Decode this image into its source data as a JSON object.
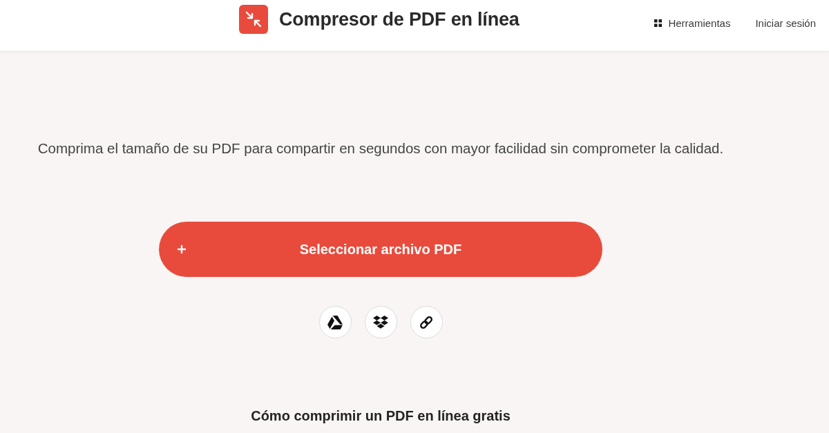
{
  "header": {
    "title": "Compresor de PDF en línea",
    "nav": [
      {
        "kind": "menu",
        "label": "Herramientas"
      },
      {
        "kind": "link",
        "label": "Iniciar sesión"
      }
    ]
  },
  "subtitle": "Comprima el tamaño de su PDF para compartir en segundos con mayor facilidad sin comprometer la calidad.",
  "upload_button": {
    "label": "Seleccionar archivo PDF"
  },
  "section_heading": "Cómo comprimir un PDF en línea gratis"
}
